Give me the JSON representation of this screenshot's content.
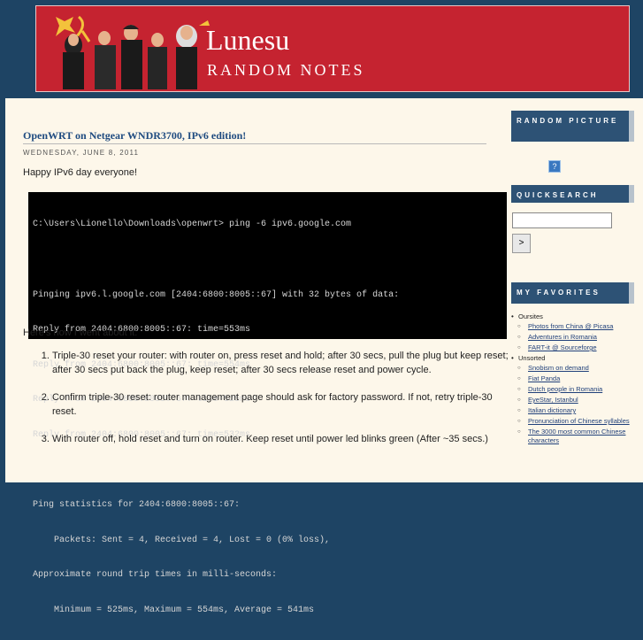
{
  "header": {
    "title": "Lunesu",
    "description": "RANDOM NOTES"
  },
  "post": {
    "title": "OpenWRT on Netgear WNDR3700, IPv6 edition!",
    "date": "WEDNESDAY, JUNE 8, 2011",
    "intro": "Happy IPv6 day everyone!",
    "console_lines": [
      "C:\\Users\\Lionello\\Downloads\\openwrt> ping -6 ipv6.google.com",
      "",
      "Pinging ipv6.l.google.com [2404:6800:8005::67] with 32 bytes of data:",
      "Reply from 2404:6800:8005::67: time=553ms",
      "Reply from 2404:6800:8005::67: time=554ms",
      "Reply from 2404:6800:8005::67: time=525ms",
      "Reply from 2404:6800:8005::67: time=532ms",
      "",
      "Ping statistics for 2404:6800:8005::67:",
      "    Packets: Sent = 4, Received = 4, Lost = 0 (0% loss),",
      "Approximate round trip times in milli-seconds:",
      "    Minimum = 525ms, Maximum = 554ms, Average = 541ms"
    ],
    "howto": "Here's how I went about it:",
    "steps": [
      "Triple-30 reset your router: with router on, press reset and hold; after 30 secs, pull the plug but keep reset; after 30 secs put back the plug, keep reset; after 30 secs release reset and power cycle.",
      "Confirm triple-30 reset: router management page should ask for factory password. If not, retry triple-30 reset.",
      "With router off, hold reset and turn on router. Keep reset until power led blinks green (After ~35 secs.)"
    ]
  },
  "sidebar": {
    "random_picture": {
      "heading": "RANDOM PICTURE",
      "icon": "?"
    },
    "quicksearch": {
      "heading": "QUICKSEARCH",
      "button": ">"
    },
    "favorites": {
      "heading": "MY FAVORITES",
      "groups": [
        {
          "name": "Oursites",
          "items": [
            "Photos from China @ Picasa",
            "Adventures in Romania",
            "FART-it @ Sourceforge"
          ]
        },
        {
          "name": "Unsorted",
          "items": [
            "Snobism on demand",
            "Fiat Panda",
            "Dutch people in Romania",
            "EyeStar, Istanbul",
            "Italian dictionary",
            "Pronunciation of Chinese syllables",
            "The 3000 most common Chinese characters"
          ]
        }
      ]
    }
  },
  "colors": {
    "banner": "#c52330",
    "page_bg": "#1e4464",
    "content_bg": "#fdf7ea",
    "sidebar_heading": "#2d5275",
    "post_title": "#1f4b80"
  }
}
